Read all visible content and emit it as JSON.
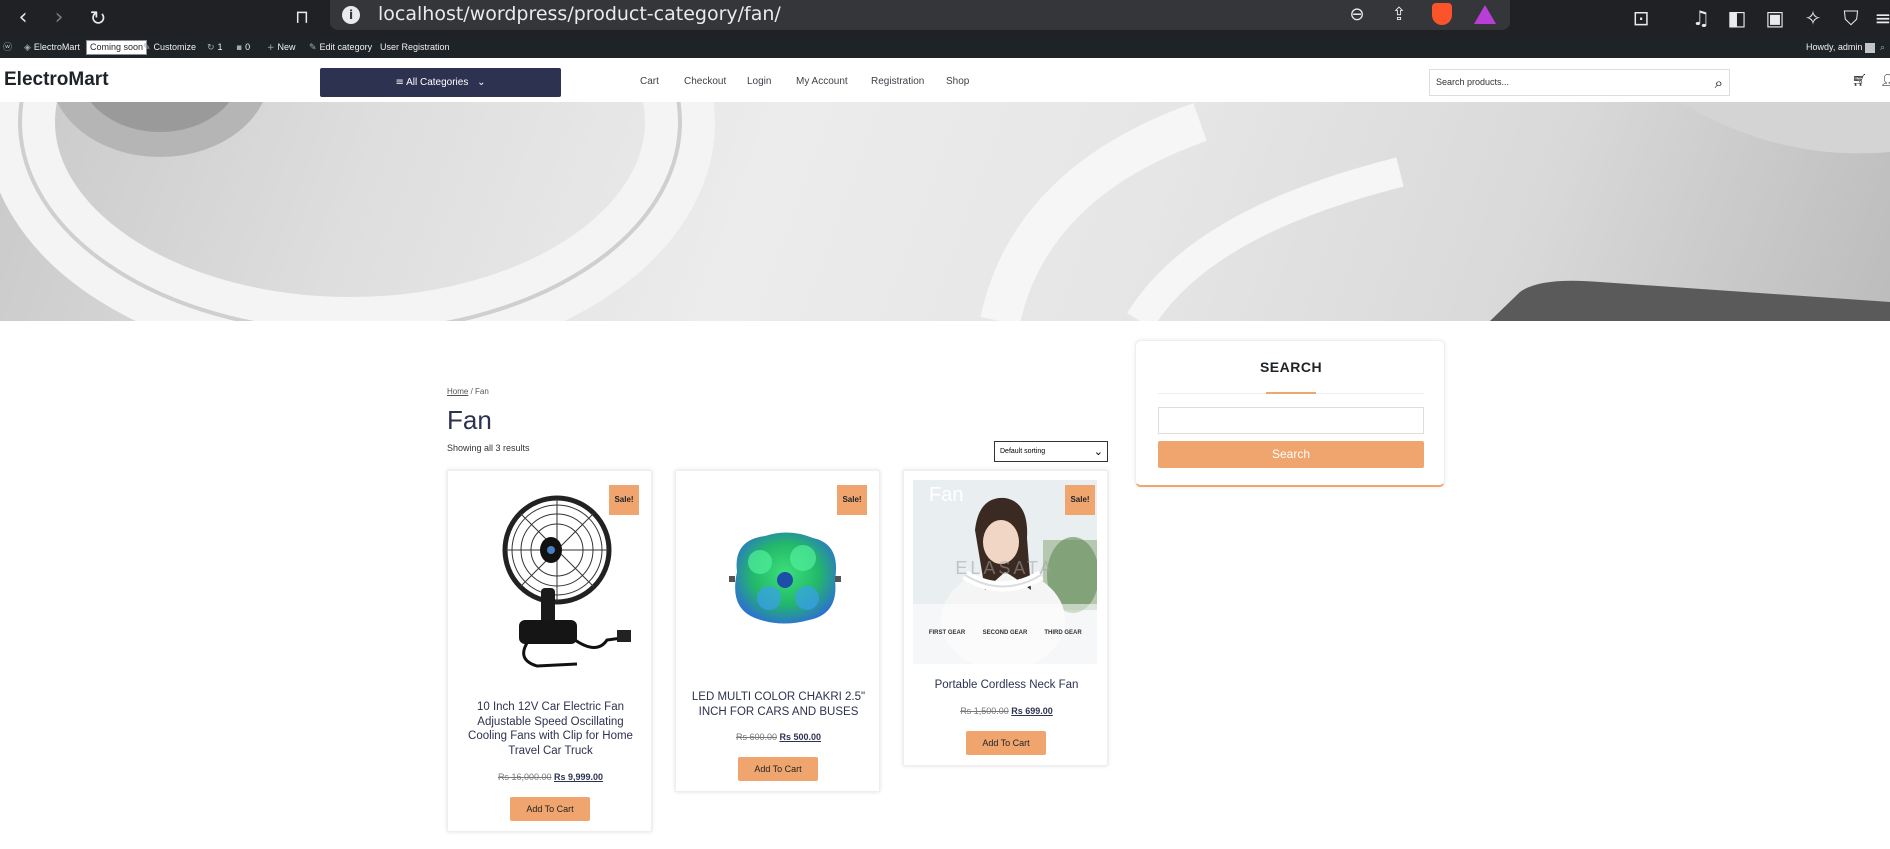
{
  "browser": {
    "url": "localhost/wordpress/product-category/fan/"
  },
  "admin_bar": {
    "site_name": "ElectroMart",
    "coming_soon": "Coming soon",
    "customize": "Customize",
    "updates": "1",
    "comments": "0",
    "new": "New",
    "edit_category": "Edit category",
    "user_registration": "User Registration",
    "howdy": "Howdy, admin"
  },
  "header": {
    "logo": "ElectroMart",
    "categories_label": "All Categories",
    "nav": [
      "Cart",
      "Checkout",
      "Login",
      "My Account",
      "Registration",
      "Shop"
    ],
    "search_placeholder": "Search products..."
  },
  "breadcrumb": {
    "home": "Home",
    "separator": " / ",
    "current": "Fan"
  },
  "page": {
    "title": "Fan",
    "result_count": "Showing all 3 results",
    "sort_selected": "Default sorting"
  },
  "products": [
    {
      "sale_badge": "Sale!",
      "title": "10 Inch 12V Car Electric Fan Adjustable Speed Oscillating Cooling Fans with Clip for Home Travel Car Truck",
      "old_price": "Rs 16,000.00",
      "new_price": "Rs 9,999.00",
      "button": "Add To Cart"
    },
    {
      "sale_badge": "Sale!",
      "title": "LED MULTI COLOR CHAKRI 2.5\" INCH FOR CARS AND BUSES",
      "old_price": "Rs 600.00",
      "new_price": "Rs 500.00",
      "button": "Add To Cart"
    },
    {
      "sale_badge": "Sale!",
      "title": "Portable Cordless Neck Fan",
      "old_price": "Rs 1,500.00",
      "new_price": "Rs 699.00",
      "button": "Add To Cart",
      "image_text": {
        "overlay": "Fan",
        "watermark": "ELASATA",
        "gears": [
          "FIRST GEAR",
          "SECOND GEAR",
          "THIRD GEAR"
        ]
      }
    }
  ],
  "sidebar": {
    "title": "SEARCH",
    "button": "Search"
  },
  "colors": {
    "accent": "#f0a46e",
    "navy": "#2d3250",
    "admin_bar": "#1d2327"
  }
}
